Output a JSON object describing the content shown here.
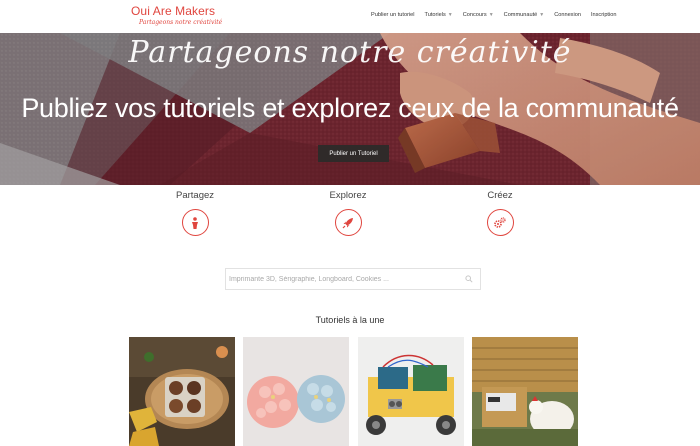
{
  "header": {
    "logo_title": "Oui Are Makers",
    "logo_tagline": "Partageons notre créativité",
    "nav": [
      {
        "label": "Publier un tutoriel",
        "has_caret": false
      },
      {
        "label": "Tutoriels",
        "has_caret": true
      },
      {
        "label": "Concours",
        "has_caret": true
      },
      {
        "label": "Communauté",
        "has_caret": true
      },
      {
        "label": "Connexion",
        "has_caret": false
      },
      {
        "label": "Inscription",
        "has_caret": false
      }
    ]
  },
  "hero": {
    "script_text": "Partageons notre créativité",
    "title": "Publiez vos tutoriels et explorez ceux de la communauté",
    "button_label": "Publier un Tutoriel"
  },
  "features": [
    {
      "label": "Partagez",
      "icon": "person-icon"
    },
    {
      "label": "Explorez",
      "icon": "rocket-icon"
    },
    {
      "label": "Créez",
      "icon": "gears-icon"
    }
  ],
  "search": {
    "placeholder": "Imprimante 3D, Sérigraphie, Longboard, Cookies ..."
  },
  "section_title": "Tutoriels à la une",
  "colors": {
    "accent": "#e0463f",
    "button_dark": "#2f2a29"
  }
}
